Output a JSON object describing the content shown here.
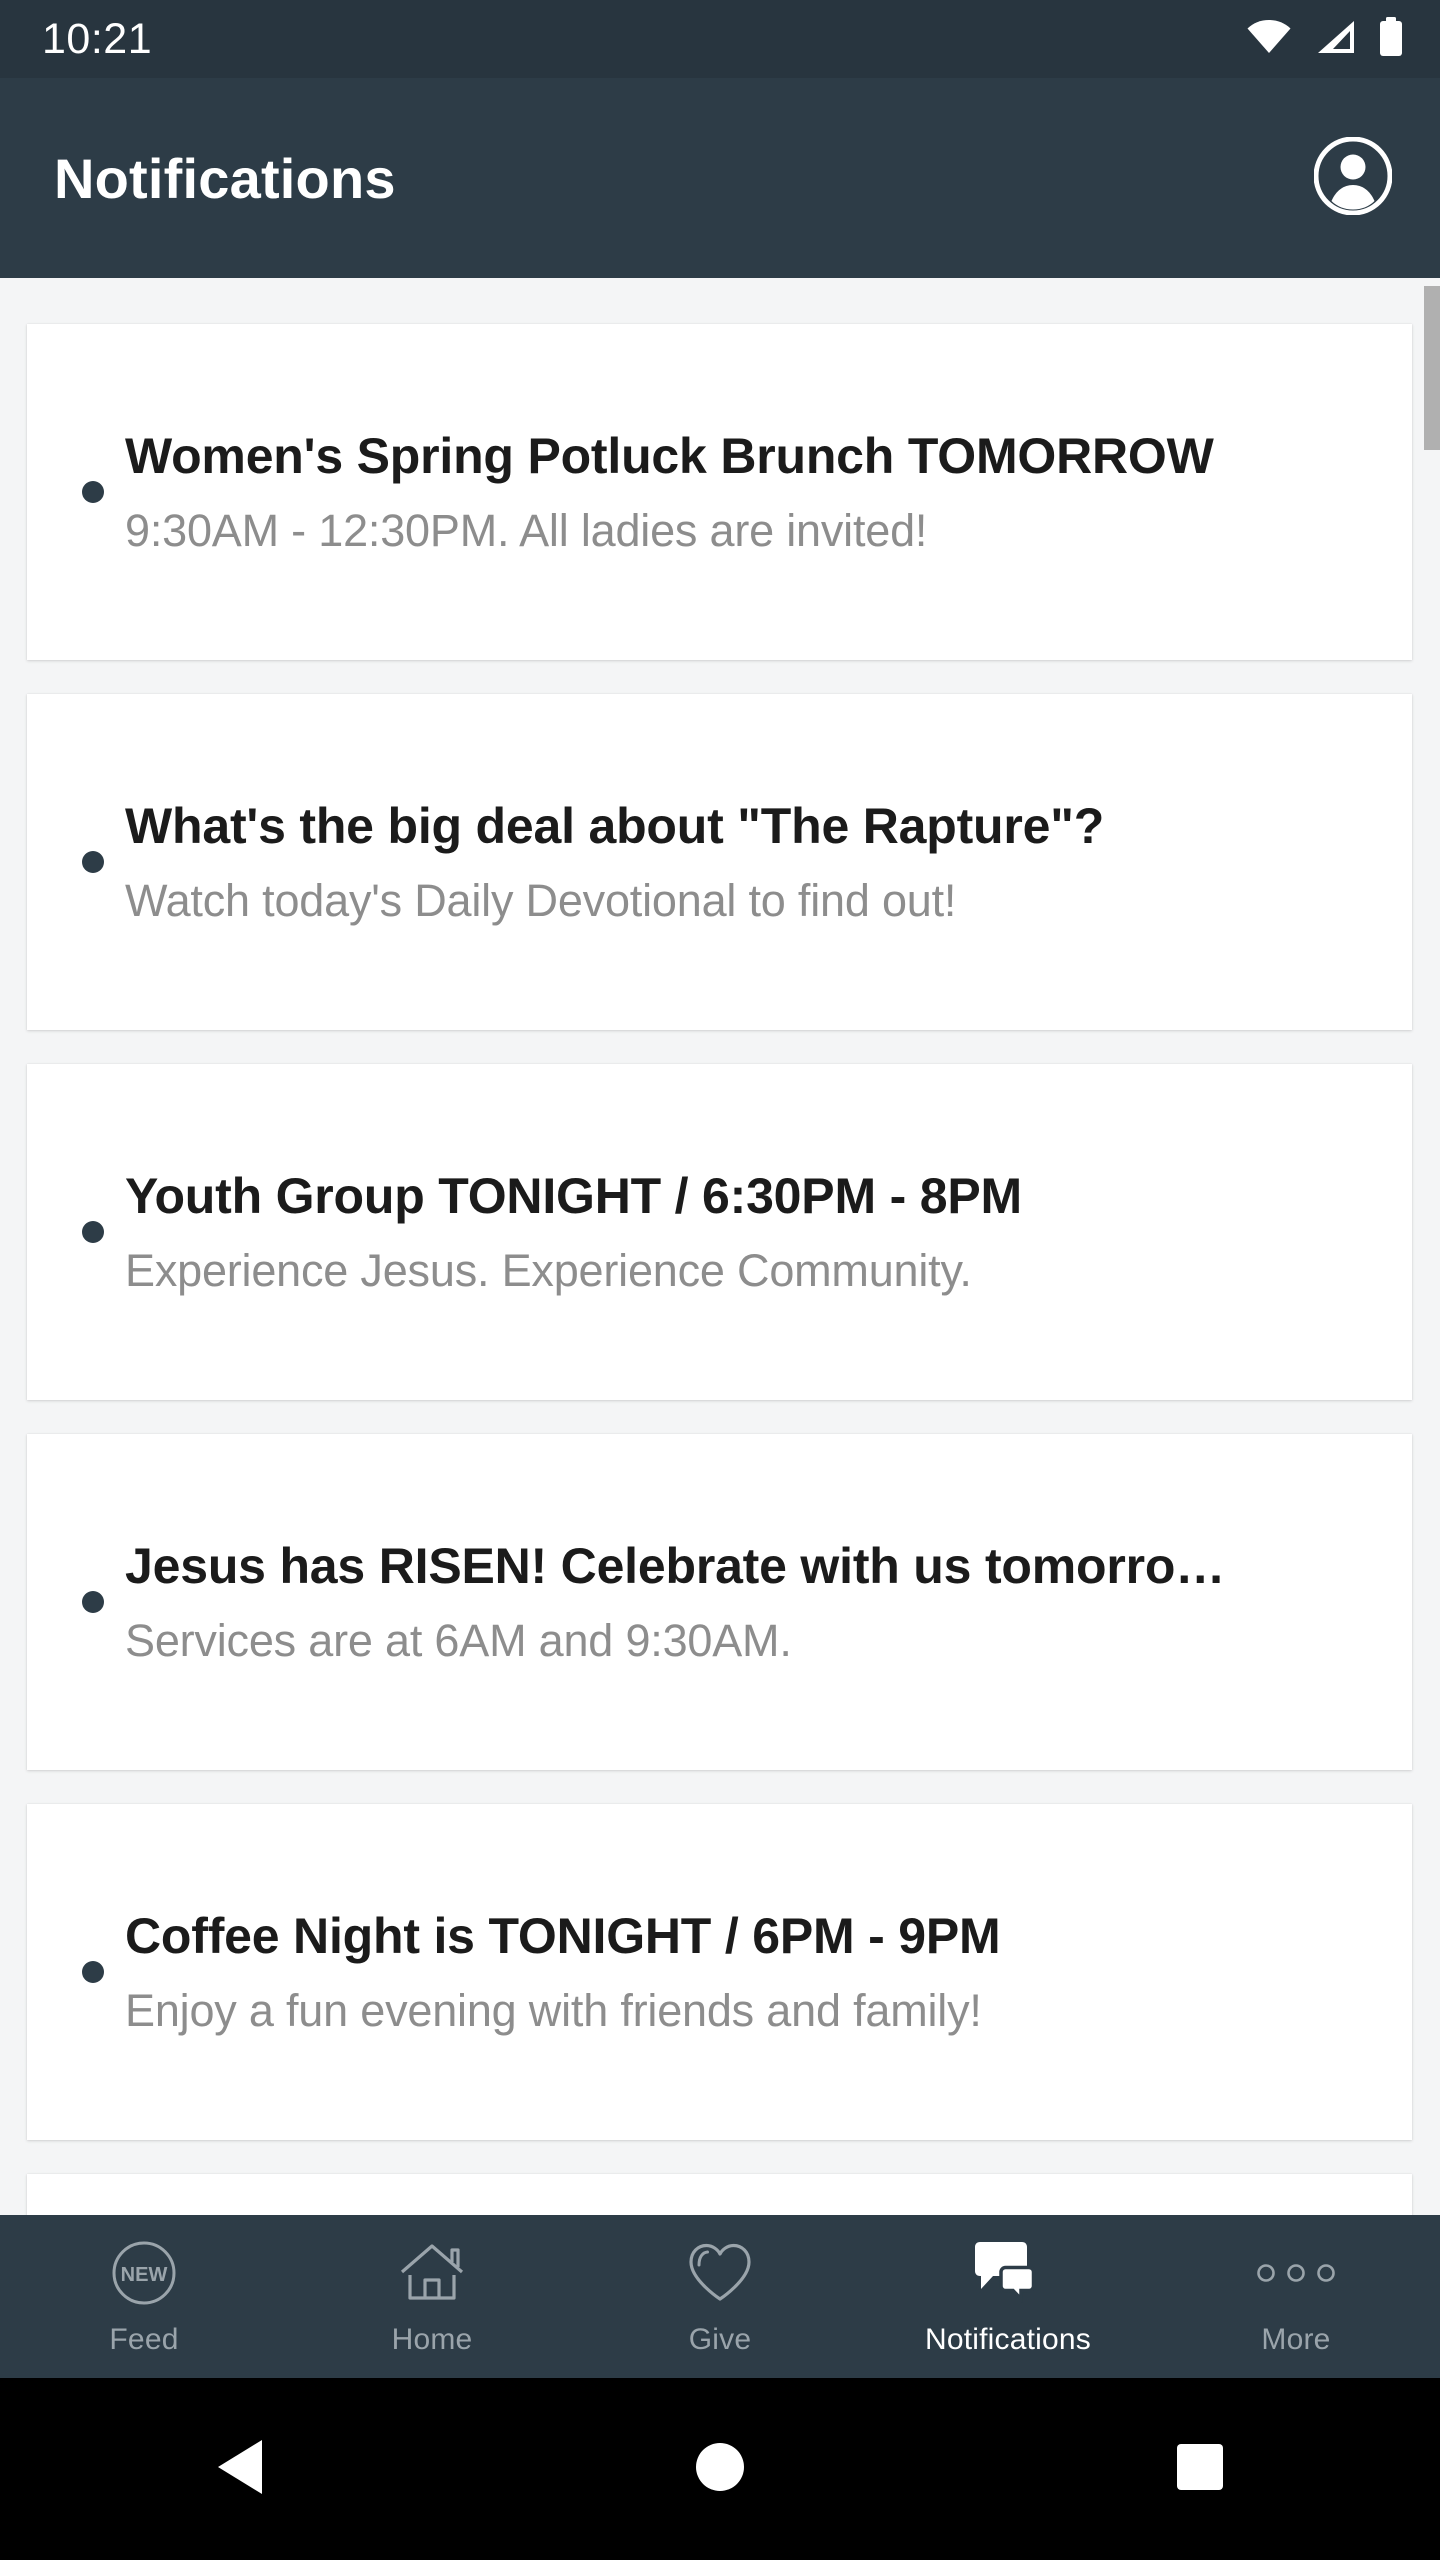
{
  "status_bar": {
    "time": "10:21",
    "icons": [
      "wifi-icon",
      "cellular-signal-icon",
      "battery-icon"
    ]
  },
  "app_bar": {
    "title": "Notifications",
    "account_icon": "account-circle-icon"
  },
  "colors": {
    "app_bar_bg": "#2d3c47",
    "status_bar_bg": "#28353f",
    "page_bg": "#f4f5f6",
    "card_bg": "#ffffff",
    "title_text": "#1b1b1b",
    "subtitle_text": "#8d8d8d",
    "bullet": "#2d3c47",
    "nav_inactive": "#9aa4ab",
    "nav_active": "#ffffff",
    "scrollbar": "#b0b0b0"
  },
  "notifications": [
    {
      "title": "Women's Spring Potluck Brunch TOMORROW",
      "subtitle": "9:30AM - 12:30PM. All ladies are invited!",
      "unread": true
    },
    {
      "title": "What's the big deal about \"The Rapture\"?",
      "subtitle": "Watch today's Daily Devotional to find out!",
      "unread": true
    },
    {
      "title": "Youth Group TONIGHT / 6:30PM - 8PM",
      "subtitle": "Experience Jesus. Experience Community.",
      "unread": true
    },
    {
      "title": "Jesus has RISEN! Celebrate with us tomorro…",
      "subtitle": "Services are at 6AM and 9:30AM.",
      "unread": true
    },
    {
      "title": "Coffee Night is TONIGHT / 6PM - 9PM",
      "subtitle": "Enjoy a fun evening with friends and family!",
      "unread": true
    },
    {
      "title": "",
      "subtitle": "",
      "unread": false
    }
  ],
  "bottom_nav": {
    "active": "Notifications",
    "items": [
      {
        "label": "Feed",
        "icon": "feed-new-circle-icon",
        "badge_text": "NEW",
        "active": false
      },
      {
        "label": "Home",
        "icon": "home-icon",
        "active": false
      },
      {
        "label": "Give",
        "icon": "heart-icon",
        "active": false
      },
      {
        "label": "Notifications",
        "icon": "chat-bubbles-icon",
        "active": true
      },
      {
        "label": "More",
        "icon": "more-dots-icon",
        "active": false
      }
    ]
  },
  "android_nav": {
    "buttons": [
      {
        "name": "back-button",
        "icon": "triangle-back-icon"
      },
      {
        "name": "home-button",
        "icon": "circle-home-icon"
      },
      {
        "name": "recents-button",
        "icon": "square-recents-icon"
      }
    ]
  }
}
